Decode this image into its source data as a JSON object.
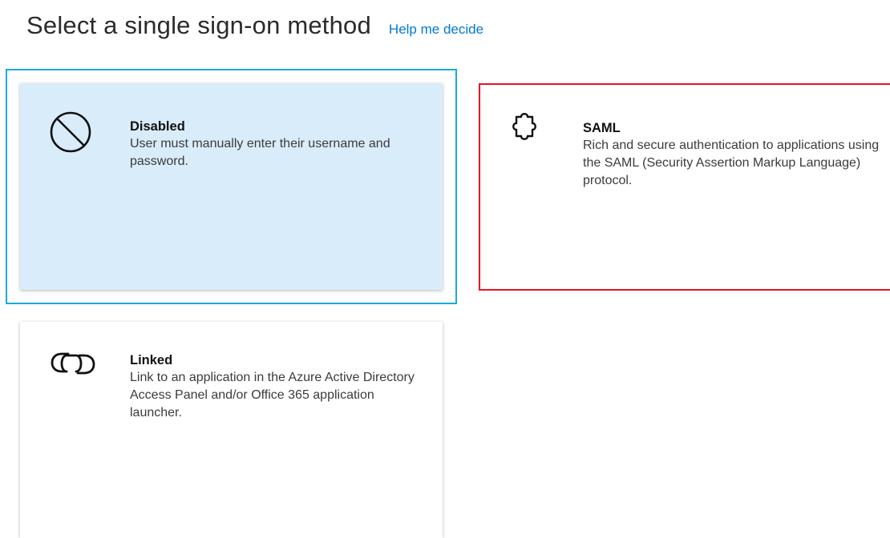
{
  "header": {
    "title": "Select a single sign-on method",
    "help_link": "Help me decide"
  },
  "tiles": [
    {
      "name": "Disabled",
      "description": "User must manually enter their username and password.",
      "icon": "no-entry-icon",
      "state": "selected"
    },
    {
      "name": "SAML",
      "description": "Rich and secure authentication to applications using the SAML (Security Assertion Markup Language) protocol.",
      "icon": "puzzle-piece-icon",
      "state": "highlighted"
    },
    {
      "name": "Linked",
      "description": "Link to an application in the Azure Active Directory Access Panel and/or Office 365 application launcher.",
      "icon": "link-icon",
      "state": "normal"
    }
  ],
  "colors": {
    "accent": "#0078d4",
    "selected_fill": "#d9ecfa",
    "selected_outline": "#1aa9e0",
    "highlight_border": "#e81123"
  }
}
